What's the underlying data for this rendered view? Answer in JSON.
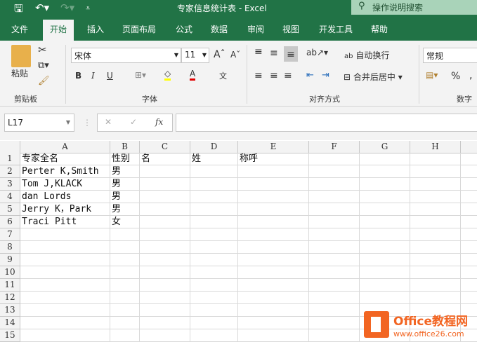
{
  "title": "专家信息统计表 - Excel",
  "search_placeholder": "操作说明搜索",
  "tabs": [
    "文件",
    "开始",
    "插入",
    "页面布局",
    "公式",
    "数据",
    "审阅",
    "视图",
    "开发工具",
    "帮助"
  ],
  "ribbon": {
    "paste": "粘贴",
    "clipboard": "剪贴板",
    "font_name": "宋体",
    "font_size": "11",
    "font_group": "字体",
    "bold": "B",
    "italic": "I",
    "underline": "U",
    "font_color": "A",
    "phonetic": "文",
    "wrap": "自动换行",
    "merge": "合并后居中",
    "align_group": "对齐方式",
    "number_format": "常规",
    "number_group": "数字",
    "percent": "%"
  },
  "name_box": "L17",
  "fx": "fx",
  "columns": [
    "A",
    "B",
    "C",
    "D",
    "E",
    "F",
    "G",
    "H"
  ],
  "rows": [
    [
      "专家全名",
      "性别",
      "名",
      "姓",
      "称呼"
    ],
    [
      "Perter K,Smith",
      "男"
    ],
    [
      "Tom J,KLACK",
      "男"
    ],
    [
      "dan Lords",
      "男"
    ],
    [
      "Jerry K，Park",
      "男"
    ],
    [
      "Traci Pitt",
      "女"
    ],
    [],
    [],
    [],
    [],
    [],
    [],
    [],
    [],
    []
  ],
  "watermark": {
    "brand": "Office教程网",
    "url": "www.office26.com"
  },
  "colors": {
    "accent": "#217346",
    "watermark": "#f26522"
  }
}
